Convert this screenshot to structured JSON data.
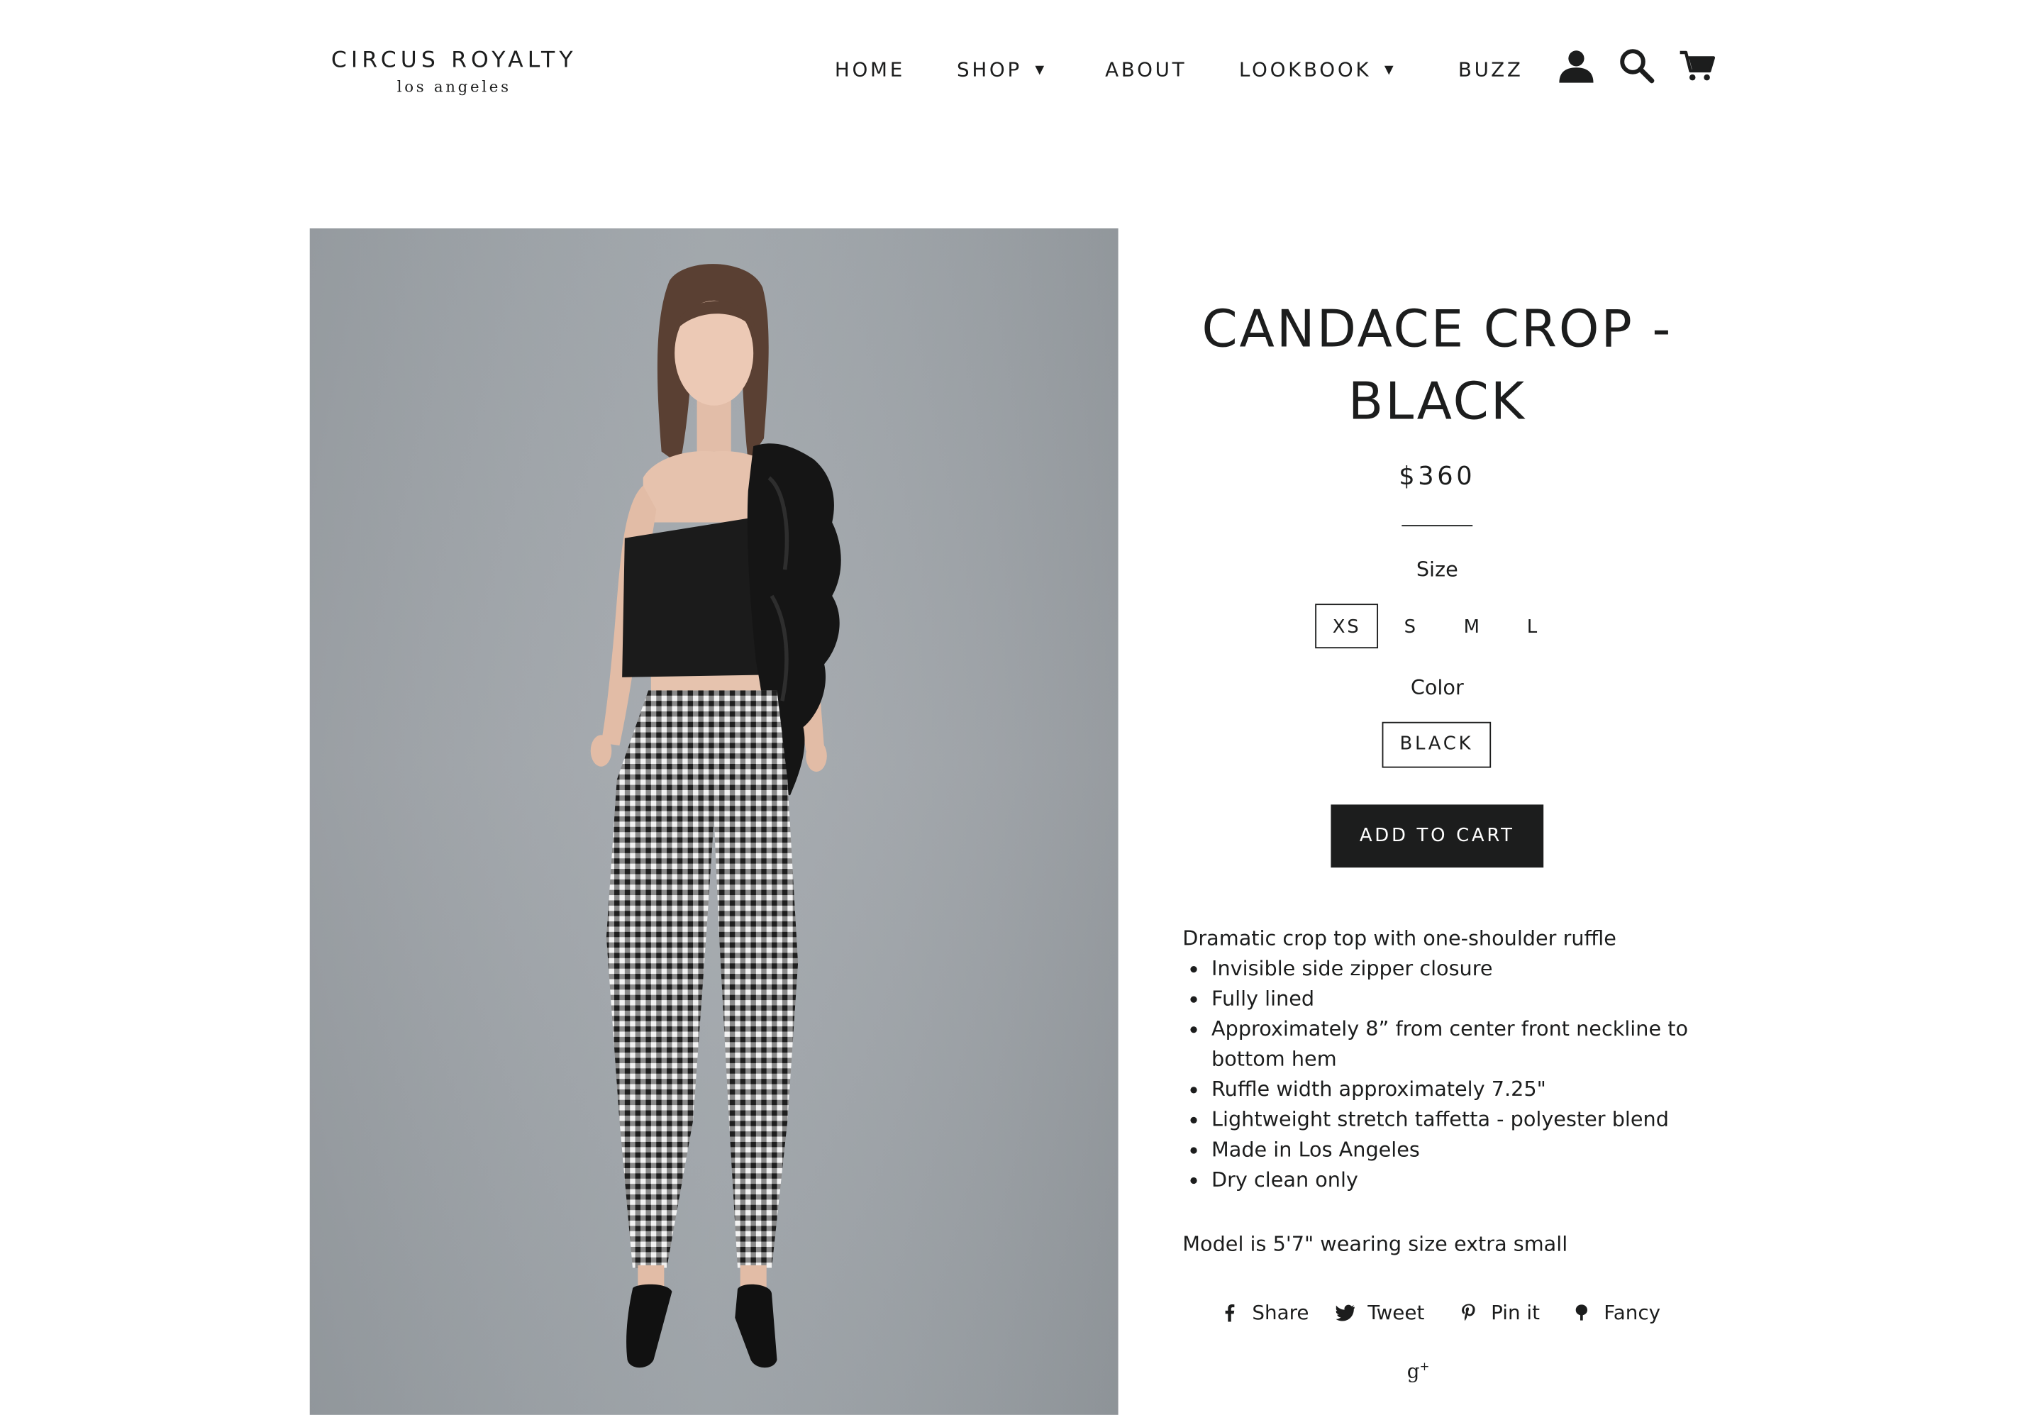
{
  "brand": {
    "name": "CIRCUS ROYALTY",
    "tagline": "los angeles"
  },
  "nav": {
    "items": [
      {
        "label": "HOME",
        "has_dropdown": false
      },
      {
        "label": "SHOP",
        "has_dropdown": true
      },
      {
        "label": "ABOUT",
        "has_dropdown": false
      },
      {
        "label": "LOOKBOOK",
        "has_dropdown": true
      },
      {
        "label": "BUZZ",
        "has_dropdown": false
      }
    ],
    "icons": [
      "account-icon",
      "search-icon",
      "cart-icon"
    ]
  },
  "product": {
    "title": "CANDACE CROP - BLACK",
    "price": "$360",
    "size": {
      "label": "Size",
      "options": [
        "XS",
        "S",
        "M",
        "L"
      ],
      "selected": "XS"
    },
    "color": {
      "label": "Color",
      "options": [
        "BLACK"
      ],
      "selected": "BLACK"
    },
    "add_to_cart": "ADD TO CART",
    "description_intro": "Dramatic crop top with one-shoulder ruffle",
    "features": [
      "Invisible side zipper closure",
      "Fully lined",
      "Approximately 8” from center front neckline to bottom hem",
      "Ruffle width approximately 7.25\"",
      "Lightweight stretch taffetta - polyester blend",
      "Made in Los Angeles",
      "Dry clean only"
    ],
    "model_note": "Model is 5'7\" wearing size extra small"
  },
  "share": {
    "facebook": "Share",
    "twitter": "Tweet",
    "pinterest": "Pin it",
    "fancy": "Fancy",
    "google_plus": "g+"
  },
  "colors": {
    "text": "#1c1d1d",
    "button_bg": "#1c1d1d",
    "button_text": "#ffffff",
    "background": "#ffffff",
    "photo_backdrop": "#a2a7ac"
  }
}
